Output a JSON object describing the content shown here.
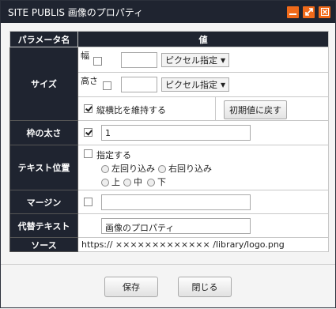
{
  "window": {
    "title": "SITE PUBLIS 画像のプロパティ"
  },
  "table": {
    "col_param": "パラメータ名",
    "col_value": "値"
  },
  "size": {
    "label": "サイズ",
    "width_label": "幅",
    "height_label": "高さ",
    "width_value": "",
    "height_value": "",
    "unit_option": "ピクセル指定",
    "keep_ratio_label": "縦横比を維持する",
    "reset_label": "初期値に戻す"
  },
  "border": {
    "label": "枠の太さ",
    "value": "1"
  },
  "text_position": {
    "label": "テキスト位置",
    "specify_label": "指定する",
    "options": [
      "左回り込み",
      "右回り込み",
      "上",
      "中",
      "下"
    ]
  },
  "margin": {
    "label": "マージン",
    "value": ""
  },
  "alt_text": {
    "label": "代替テキスト",
    "value": "画像のプロパティ"
  },
  "source": {
    "label": "ソース",
    "value": "https:// ××××××××××××× /library/logo.png"
  },
  "footer": {
    "save_label": "保存",
    "close_label": "閉じる"
  },
  "colors": {
    "titlebar": "#1f2430",
    "window_button": "#f06a1a"
  }
}
